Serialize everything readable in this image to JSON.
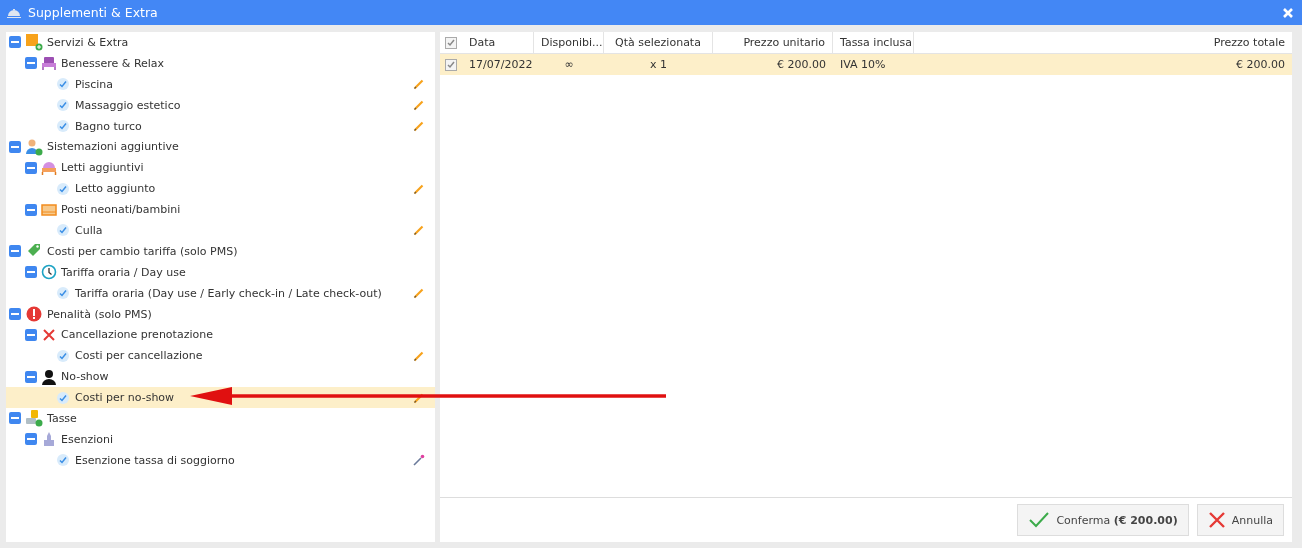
{
  "window": {
    "title": "Supplementi & Extra"
  },
  "tree": [
    {
      "label": "Servizi & Extra",
      "expanded": true,
      "selected": false,
      "children": [
        {
          "label": "Benessere & Relax",
          "expanded": true,
          "selected": false,
          "children": [
            {
              "label": "Piscina",
              "checked": true,
              "selected": false
            },
            {
              "label": "Massaggio estetico",
              "checked": true,
              "selected": false
            },
            {
              "label": "Bagno turco",
              "checked": true,
              "selected": false
            }
          ]
        }
      ]
    },
    {
      "label": "Sistemazioni aggiuntive",
      "expanded": true,
      "selected": false,
      "children": [
        {
          "label": "Letti aggiuntivi",
          "expanded": true,
          "selected": false,
          "children": [
            {
              "label": "Letto aggiunto",
              "checked": true,
              "selected": false
            }
          ]
        },
        {
          "label": "Posti neonati/bambini",
          "expanded": true,
          "selected": false,
          "children": [
            {
              "label": "Culla",
              "checked": true,
              "selected": false
            }
          ]
        }
      ]
    },
    {
      "label": "Costi per cambio tariffa (solo PMS)",
      "expanded": true,
      "selected": false,
      "children": [
        {
          "label": "Tariffa oraria / Day use",
          "expanded": true,
          "selected": false,
          "children": [
            {
              "label": "Tariffa oraria (Day use / Early check-in / Late check-out)",
              "checked": true,
              "selected": false
            }
          ]
        }
      ]
    },
    {
      "label": "Penalità (solo PMS)",
      "expanded": true,
      "selected": false,
      "children": [
        {
          "label": "Cancellazione prenotazione",
          "expanded": true,
          "selected": false,
          "children": [
            {
              "label": "Costi per cancellazione",
              "checked": true,
              "selected": false
            }
          ]
        },
        {
          "label": "No-show",
          "expanded": true,
          "selected": false,
          "children": [
            {
              "label": "Costi per no-show",
              "checked": true,
              "selected": true
            }
          ]
        }
      ]
    },
    {
      "label": "Tasse",
      "expanded": true,
      "selected": false,
      "children": [
        {
          "label": "Esenzioni",
          "expanded": true,
          "selected": false,
          "children": [
            {
              "label": "Esenzione tassa di soggiorno",
              "checked": true,
              "selected": false
            }
          ]
        }
      ]
    }
  ],
  "table": {
    "all_checked": true,
    "columns": [
      "Data",
      "Disponibi...",
      "Qtà selezionata",
      "Prezzo unitario",
      "Tassa inclusa",
      "Prezzo totale"
    ],
    "rows": [
      {
        "checked": true,
        "selected": true,
        "cells": [
          "17/07/2022",
          "∞",
          "x 1",
          "€ 200.00",
          "IVA 10%",
          "€ 200.00"
        ]
      }
    ]
  },
  "buttons": [
    {
      "kind": "confirm",
      "label": "Conferma **(€ 200.00)**"
    },
    {
      "kind": "cancel",
      "label": "Annulla"
    }
  ]
}
